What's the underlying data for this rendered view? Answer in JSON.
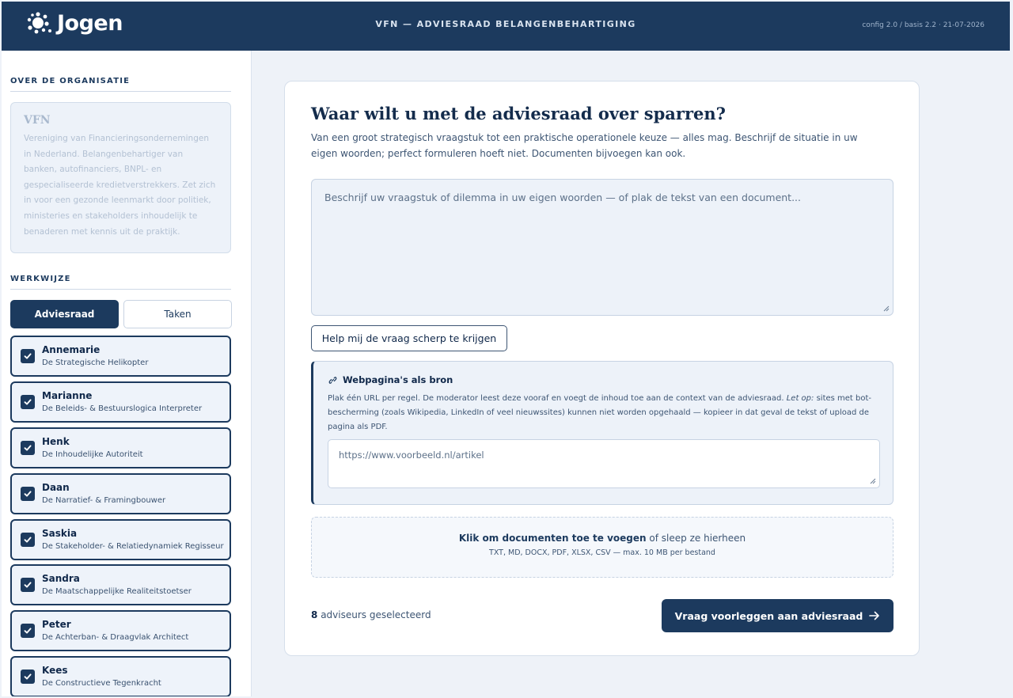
{
  "header": {
    "logo_text": "Jogen",
    "title": "VFN — ADVIESRAAD BELANGENBEHARTIGING",
    "version": "config 2.0 / basis 2.2 · 21-07-2026"
  },
  "sidebar": {
    "org_section_label": "OVER DE ORGANISATIE",
    "org_name": "VFN",
    "org_description": "Vereniging van Financieringsondernemingen in Nederland. Belangenbehartiger van banken, autofinanciers, BNPL- en gespecialiseerde kredietverstrekkers. Zet zich in voor een gezonde leenmarkt door politiek, ministeries en stakeholders inhoudelijk te benaderen met kennis uit de praktijk.",
    "workflow_section_label": "WERKWIJZE",
    "toggle": {
      "active": "Adviesraad",
      "inactive": "Taken"
    },
    "advisors": [
      {
        "name": "Annemarie",
        "role": "De Strategische Helikopter",
        "checked": true
      },
      {
        "name": "Marianne",
        "role": "De Beleids- & Bestuurslogica Interpreter",
        "checked": true
      },
      {
        "name": "Henk",
        "role": "De Inhoudelijke Autoriteit",
        "checked": true
      },
      {
        "name": "Daan",
        "role": "De Narratief- & Framingbouwer",
        "checked": true
      },
      {
        "name": "Saskia",
        "role": "De Stakeholder- & Relatiedynamiek Regisseur",
        "checked": true
      },
      {
        "name": "Sandra",
        "role": "De Maatschappelijke Realiteitstoetser",
        "checked": true
      },
      {
        "name": "Peter",
        "role": "De Achterban- & Draagvlak Architect",
        "checked": true
      },
      {
        "name": "Kees",
        "role": "De Constructieve Tegenkracht",
        "checked": true
      }
    ]
  },
  "main": {
    "title": "Waar wilt u met de adviesraad over sparren?",
    "subtitle": "Van een groot strategisch vraagstuk tot een praktische operationele keuze — alles mag. Beschrijf de situatie in uw eigen woorden; perfect formuleren hoeft niet. Documenten bijvoegen kan ook.",
    "question_placeholder": "Beschrijf uw vraagstuk of dilemma in uw eigen woorden — of plak de tekst van een document...",
    "help_button": "Help mij de vraag scherp te krijgen",
    "web": {
      "title": "Webpagina's als bron",
      "desc_part1": "Plak één URL per regel. De moderator leest deze vooraf en voegt de inhoud toe aan de context van de adviesraad.",
      "desc_em": "Let op:",
      "desc_part2": "sites met bot-bescherming (zoals Wikipedia, LinkedIn of veel nieuwssites) kunnen niet worden opgehaald — kopieer in dat geval de tekst of upload de pagina als PDF.",
      "url_placeholder": "https://www.voorbeeld.nl/artikel"
    },
    "dropzone": {
      "link_text": "Klik om documenten toe te voegen",
      "rest_text": "of sleep ze hierheen",
      "formats": "TXT, MD, DOCX, PDF, XLSX, CSV — max. 10 MB per bestand"
    },
    "footer": {
      "count": "8",
      "count_label": "adviseurs geselecteerd",
      "submit": "Vraag voorleggen aan adviesraad"
    }
  },
  "colors": {
    "primary": "#1c3a5e",
    "background": "#eef2f8",
    "field_bg": "#edf2f9"
  }
}
